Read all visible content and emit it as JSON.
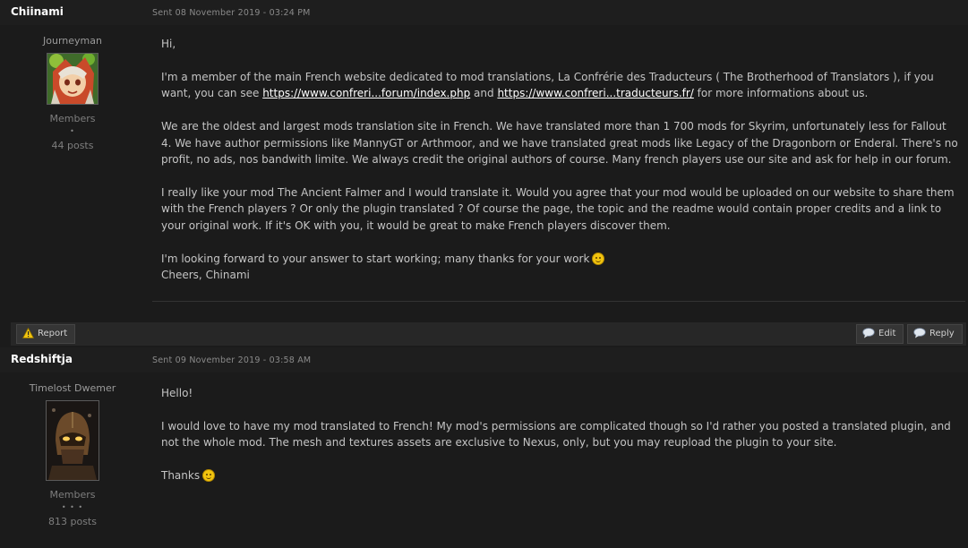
{
  "posts": [
    {
      "author": "Chiinami",
      "date": "Sent 08 November 2019 - 03:24 PM",
      "rank": "Journeyman",
      "group": "Members",
      "pips": "•",
      "posts": "44 posts",
      "body": {
        "p1": "Hi,",
        "p2_pre": "I'm a member of the main French website dedicated to mod translations, La Confrérie des Traducteurs ( The Brotherhood of Translators ), if you want, you can see ",
        "link1": "https://www.confreri...forum/index.php",
        "p2_mid": " and ",
        "link2": "https://www.confreri...traducteurs.fr/",
        "p2_post": " for more informations about us.",
        "p3": "We are the oldest and largest mods translation site in French. We have translated more than 1 700 mods for Skyrim, unfortunately less for Fallout 4. We have author permissions like MannyGT or Arthmoor, and we have translated great mods like Legacy of the Dragonborn or Enderal. There's no profit, no ads, nos bandwith limite. We always credit the original authors of course. Many french players use our site and ask for help in our forum.",
        "p4": "I really like your mod The Ancient Falmer and I would translate it. Would you agree that your mod would be uploaded on our website to share them with the French players ? Or only the plugin translated ? Of course the page, the topic and the readme would contain proper credits and a link to your original work. If it's OK with you, it would be great to make French players discover them.",
        "p5": "I'm looking forward to your answer to start working; many thanks for your work",
        "p6": "Cheers, Chinami"
      }
    },
    {
      "author": "Redshiftja",
      "date": "Sent 09 November 2019 - 03:58 AM",
      "rank": "Timelost Dwemer",
      "group": "Members",
      "pips": "• • •",
      "posts": "813 posts",
      "body": {
        "p1": "Hello!",
        "p2": "I would love to have my mod translated to French! My mod's permissions are complicated though so I'd rather you posted a translated plugin, and not the whole mod. The mesh and textures assets are exclusive to Nexus, only, but you may reupload the plugin to your site.",
        "p3": "Thanks"
      }
    }
  ],
  "actions": {
    "report": "Report",
    "edit": "Edit",
    "reply": "Reply"
  },
  "icons": {
    "report": "warning-icon",
    "edit": "chat-bubble-icon",
    "reply": "chat-bubble-icon",
    "smiley_wink": "wink-smiley-icon",
    "smiley_happy": "happy-smiley-icon"
  },
  "colors": {
    "background": "#1b1b1b",
    "header": "#1e1e1e",
    "text": "#c4c4c4",
    "link": "#ffffff",
    "action_bar": "#272727"
  }
}
